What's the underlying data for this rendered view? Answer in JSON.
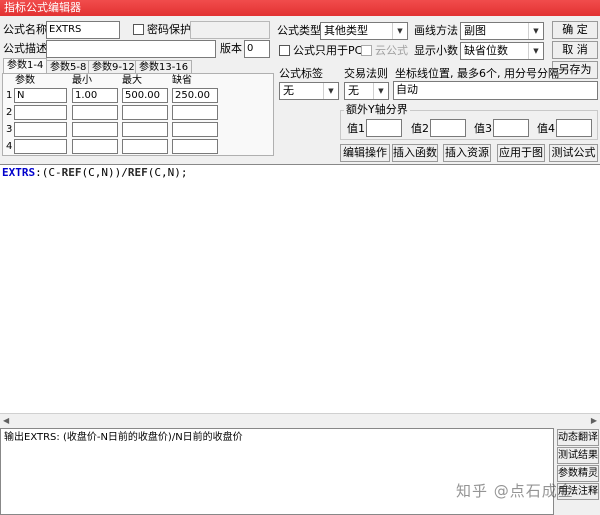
{
  "window": {
    "title": "指标公式编辑器"
  },
  "formula": {
    "name_label": "公式名称",
    "name_value": "EXTRS",
    "password_label": "密码保护",
    "desc_label": "公式描述",
    "desc_value": "",
    "version_label": "版本",
    "version_value": "0"
  },
  "type_row": {
    "formula_type_label": "公式类型",
    "formula_type_value": "其他类型",
    "draw_method_label": "画线方法",
    "draw_method_value": "副图"
  },
  "options_row": {
    "pc_only_label": "公式只用于PC",
    "cloud_label": "云公式",
    "decimals_label": "显示小数",
    "decimals_value": "缺省位数"
  },
  "buttons": {
    "ok": "确  定",
    "cancel": "取  消",
    "save_as": "另存为"
  },
  "tabs": [
    "参数1-4",
    "参数5-8",
    "参数9-12",
    "参数13-16"
  ],
  "params": {
    "headers": [
      "参数",
      "最小",
      "最大",
      "缺省"
    ],
    "rows": [
      {
        "num": "1",
        "name": "N",
        "min": "1.00",
        "max": "500.00",
        "default": "250.00"
      },
      {
        "num": "2",
        "name": "",
        "min": "",
        "max": "",
        "default": ""
      },
      {
        "num": "3",
        "name": "",
        "min": "",
        "max": "",
        "default": ""
      },
      {
        "num": "4",
        "name": "",
        "min": "",
        "max": "",
        "default": ""
      }
    ]
  },
  "tags": {
    "formula_tag_label": "公式标签",
    "formula_tag_value": "无",
    "trade_rule_label": "交易法则",
    "trade_rule_value": "无",
    "coord_label": "坐标线位置, 最多6个, 用分号分隔",
    "coord_value": "自动"
  },
  "extra_axis": {
    "title": "额外Y轴分界",
    "labels": [
      "值1",
      "值2",
      "值3",
      "值4"
    ]
  },
  "actions": [
    "编辑操作",
    "插入函数",
    "插入资源",
    "应用于图",
    "测试公式"
  ],
  "code": {
    "name": "EXTRS",
    "sep": ":",
    "body_1": "(C-",
    "fn_1": "REF",
    "body_2": "(C,N))/",
    "fn_2": "REF",
    "body_3": "(C,N);"
  },
  "output_text": "输出EXTRS: (收盘价-N日前的收盘价)/N日前的收盘价",
  "side_buttons": [
    "动态翻译",
    "测试结果",
    "参数精灵",
    "用法注释"
  ],
  "watermark": "知乎 @点石成金"
}
